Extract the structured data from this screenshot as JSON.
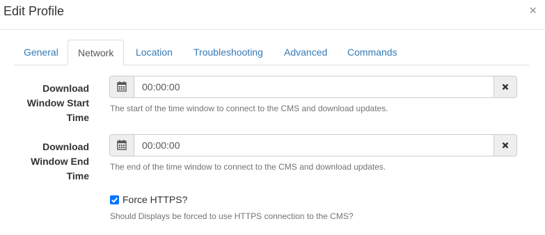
{
  "dialog": {
    "title": "Edit Profile",
    "close_label": "×"
  },
  "tabs": [
    {
      "label": "General",
      "active": false
    },
    {
      "label": "Network",
      "active": true
    },
    {
      "label": "Location",
      "active": false
    },
    {
      "label": "Troubleshooting",
      "active": false
    },
    {
      "label": "Advanced",
      "active": false
    },
    {
      "label": "Commands",
      "active": false
    }
  ],
  "fields": {
    "start": {
      "label_lines": [
        "Download",
        "Window Start",
        "Time"
      ],
      "value": "00:00:00",
      "help": "The start of the time window to connect to the CMS and download updates."
    },
    "end": {
      "label_lines": [
        "Download",
        "Window End",
        "Time"
      ],
      "value": "00:00:00",
      "help": "The end of the time window to connect to the CMS and download updates."
    },
    "force_https": {
      "label": "Force HTTPS?",
      "checked": true,
      "help": "Should Displays be forced to use HTTPS connection to the CMS?"
    }
  },
  "icons": {
    "calendar": "calendar-icon",
    "clear": "times-icon",
    "close": "close-icon"
  },
  "colors": {
    "link": "#337ab7",
    "checkbox": "#0075ff",
    "addon_bg": "#eeeeee",
    "help_text": "#737373"
  }
}
